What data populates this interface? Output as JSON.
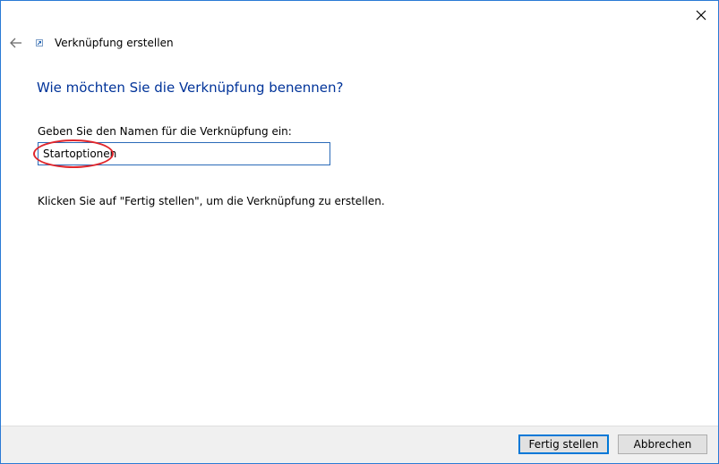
{
  "window": {
    "title": "Verknüpfung erstellen",
    "heading": "Wie möchten Sie die Verknüpfung benennen?",
    "accent_color": "#2a7ad5",
    "heading_color": "#003399"
  },
  "icons": {
    "close": "close-icon",
    "back": "back-arrow-icon",
    "wizard": "shortcut-icon"
  },
  "form": {
    "name_label": "Geben Sie den Namen für die Verknüpfung ein:",
    "name_value": "Startoptionen",
    "highlight_color": "#e0262c"
  },
  "hint": "Klicken Sie auf \"Fertig stellen\", um die Verknüpfung zu erstellen.",
  "buttons": {
    "finish": "Fertig stellen",
    "cancel": "Abbrechen"
  }
}
